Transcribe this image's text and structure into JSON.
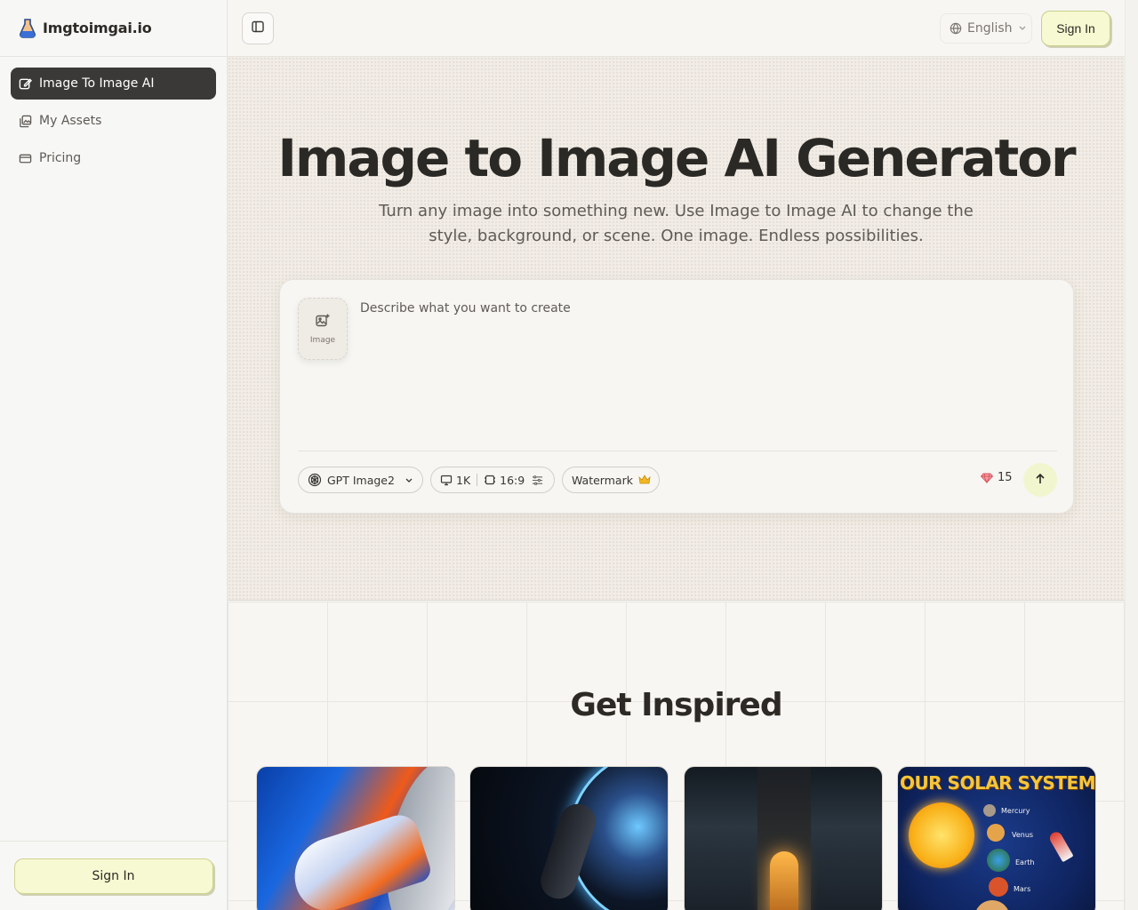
{
  "brand": {
    "name": "Imgtoimgai.io"
  },
  "sidebar": {
    "items": [
      {
        "label": "Image To Image AI",
        "icon": "edit-icon",
        "active": true
      },
      {
        "label": "My Assets",
        "icon": "images-icon",
        "active": false
      },
      {
        "label": "Pricing",
        "icon": "credit-card-icon",
        "active": false
      }
    ],
    "sign_in_label": "Sign In"
  },
  "topbar": {
    "language": "English",
    "sign_in_label": "Sign In"
  },
  "hero": {
    "title": "Image to Image AI Generator",
    "subtitle": "Turn any image into something new. Use Image to Image AI to change the style, background, or scene. One image. Endless possibilities."
  },
  "prompt": {
    "upload_label": "Image",
    "placeholder": "Describe what you want to create",
    "value": "",
    "model": "GPT Image2",
    "resolution": "1K",
    "aspect_ratio": "16:9",
    "watermark_label": "Watermark",
    "credits": "15"
  },
  "inspired": {
    "title": "Get Inspired",
    "solar_card": {
      "title": "OUR SOLAR SYSTEM",
      "planets": [
        "Mercury",
        "Venus",
        "Earth",
        "Mars"
      ]
    }
  },
  "colors": {
    "accent_yellow": "#f6f9d1",
    "active_nav": "#3a3937",
    "hero_bg": "#f1ece5"
  }
}
